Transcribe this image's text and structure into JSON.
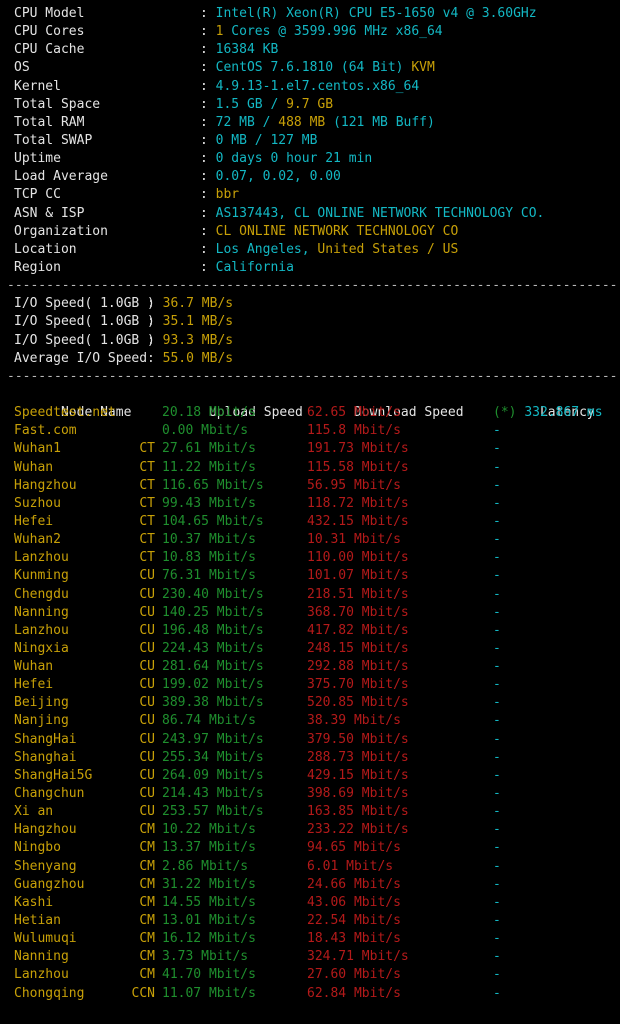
{
  "terminal": {
    "colors": {
      "background": "#000000",
      "label": "#e4e4e4",
      "cyan": "#13b8c4",
      "yellow": "#c7a008",
      "green": "#1f8f2e",
      "red": "#b41a1a",
      "separator": "#b9b9b9"
    },
    "separator_char": "-"
  },
  "system_info": {
    "rows": [
      {
        "label": "CPU Model",
        "colon": ":",
        "parts": [
          {
            "text": "Intel(R) Xeon(R) CPU E5-1650 v4 @ 3.60GHz",
            "color": "cyan"
          }
        ]
      },
      {
        "label": "CPU Cores",
        "colon": ":",
        "parts": [
          {
            "text": "1",
            "color": "yellow"
          },
          {
            "text": " Cores @ 3599.996 MHz x86_64",
            "color": "cyan"
          }
        ]
      },
      {
        "label": "CPU Cache",
        "colon": ":",
        "parts": [
          {
            "text": "16384 KB",
            "color": "cyan"
          }
        ]
      },
      {
        "label": "OS",
        "colon": ":",
        "parts": [
          {
            "text": "CentOS 7.6.1810 (64 Bit) ",
            "color": "cyan"
          },
          {
            "text": "KVM",
            "color": "yellow"
          }
        ]
      },
      {
        "label": "Kernel",
        "colon": ":",
        "parts": [
          {
            "text": "4.9.13-1.el7.centos.x86_64",
            "color": "cyan"
          }
        ]
      },
      {
        "label": "Total Space",
        "colon": ":",
        "parts": [
          {
            "text": "1.5 GB",
            "color": "cyan"
          },
          {
            "text": " / ",
            "color": "cyan"
          },
          {
            "text": "9.7 GB",
            "color": "yellow"
          }
        ]
      },
      {
        "label": "Total RAM",
        "colon": ":",
        "parts": [
          {
            "text": "72 MB",
            "color": "cyan"
          },
          {
            "text": " / ",
            "color": "cyan"
          },
          {
            "text": "488 MB",
            "color": "yellow"
          },
          {
            "text": " (121 MB Buff)",
            "color": "cyan"
          }
        ]
      },
      {
        "label": "Total SWAP",
        "colon": ":",
        "parts": [
          {
            "text": "0 MB / 127 MB",
            "color": "cyan"
          }
        ]
      },
      {
        "label": "Uptime",
        "colon": ":",
        "parts": [
          {
            "text": "0 days 0 hour 21 min",
            "color": "cyan"
          }
        ]
      },
      {
        "label": "Load Average",
        "colon": ":",
        "parts": [
          {
            "text": "0.07, 0.02, 0.00",
            "color": "cyan"
          }
        ]
      },
      {
        "label": "TCP CC",
        "colon": ":",
        "parts": [
          {
            "text": "bbr",
            "color": "yellow"
          }
        ]
      },
      {
        "label": "ASN & ISP",
        "colon": ":",
        "parts": [
          {
            "text": "AS137443, CL ONLINE NETWORK TECHNOLOGY CO.",
            "color": "cyan"
          }
        ]
      },
      {
        "label": "Organization",
        "colon": ":",
        "parts": [
          {
            "text": "CL ONLINE NETWORK TECHNOLOGY CO",
            "color": "yellow"
          }
        ]
      },
      {
        "label": "Location",
        "colon": ":",
        "parts": [
          {
            "text": "Los Angeles, ",
            "color": "cyan"
          },
          {
            "text": "United States / US",
            "color": "yellow"
          }
        ]
      },
      {
        "label": "Region",
        "colon": ":",
        "parts": [
          {
            "text": "California",
            "color": "cyan"
          }
        ]
      }
    ]
  },
  "io_speed": {
    "rows": [
      {
        "label": "I/O Speed( 1.0GB )",
        "colon": ":",
        "value": "36.7 MB/s"
      },
      {
        "label": "I/O Speed( 1.0GB )",
        "colon": ":",
        "value": "35.1 MB/s"
      },
      {
        "label": "I/O Speed( 1.0GB )",
        "colon": ":",
        "value": "93.3 MB/s"
      },
      {
        "label": "Average I/O Speed",
        "colon": ":",
        "value": "55.0 MB/s"
      }
    ]
  },
  "speedtest": {
    "headers": {
      "node": "Node Name",
      "carrier": "",
      "upload": "Upload Speed",
      "download": "Download Speed",
      "latency": "Latency"
    },
    "rows": [
      {
        "node": "Speedtest.net",
        "carrier": "",
        "upload": "20.18 Mbit/s",
        "download": "62.65 Mbit/s",
        "latency_mark": "(*)",
        "latency": "332.867 ms"
      },
      {
        "node": "Fast.com",
        "carrier": "",
        "upload": "0.00 Mbit/s",
        "download": "115.8 Mbit/s",
        "latency_mark": "",
        "latency": "-"
      },
      {
        "node": "Wuhan1",
        "carrier": "CT",
        "upload": "27.61 Mbit/s",
        "download": "191.73 Mbit/s",
        "latency_mark": "",
        "latency": "-"
      },
      {
        "node": "Wuhan",
        "carrier": "CT",
        "upload": "11.22 Mbit/s",
        "download": "115.58 Mbit/s",
        "latency_mark": "",
        "latency": "-"
      },
      {
        "node": "Hangzhou",
        "carrier": "CT",
        "upload": "116.65 Mbit/s",
        "download": "56.95 Mbit/s",
        "latency_mark": "",
        "latency": "-"
      },
      {
        "node": "Suzhou",
        "carrier": "CT",
        "upload": "99.43 Mbit/s",
        "download": "118.72 Mbit/s",
        "latency_mark": "",
        "latency": "-"
      },
      {
        "node": "Hefei",
        "carrier": "CT",
        "upload": "104.65 Mbit/s",
        "download": "432.15 Mbit/s",
        "latency_mark": "",
        "latency": "-"
      },
      {
        "node": "Wuhan2",
        "carrier": "CT",
        "upload": "10.37 Mbit/s",
        "download": "10.31 Mbit/s",
        "latency_mark": "",
        "latency": "-"
      },
      {
        "node": "Lanzhou",
        "carrier": "CT",
        "upload": "10.83 Mbit/s",
        "download": "110.00 Mbit/s",
        "latency_mark": "",
        "latency": "-"
      },
      {
        "node": "Kunming",
        "carrier": "CU",
        "upload": "76.31 Mbit/s",
        "download": "101.07 Mbit/s",
        "latency_mark": "",
        "latency": "-"
      },
      {
        "node": "Chengdu",
        "carrier": "CU",
        "upload": "230.40 Mbit/s",
        "download": "218.51 Mbit/s",
        "latency_mark": "",
        "latency": "-"
      },
      {
        "node": "Nanning",
        "carrier": "CU",
        "upload": "140.25 Mbit/s",
        "download": "368.70 Mbit/s",
        "latency_mark": "",
        "latency": "-"
      },
      {
        "node": "Lanzhou",
        "carrier": "CU",
        "upload": "196.48 Mbit/s",
        "download": "417.82 Mbit/s",
        "latency_mark": "",
        "latency": "-"
      },
      {
        "node": "Ningxia",
        "carrier": "CU",
        "upload": "224.43 Mbit/s",
        "download": "248.15 Mbit/s",
        "latency_mark": "",
        "latency": "-"
      },
      {
        "node": "Wuhan",
        "carrier": "CU",
        "upload": "281.64 Mbit/s",
        "download": "292.88 Mbit/s",
        "latency_mark": "",
        "latency": "-"
      },
      {
        "node": "Hefei",
        "carrier": "CU",
        "upload": "199.02 Mbit/s",
        "download": "375.70 Mbit/s",
        "latency_mark": "",
        "latency": "-"
      },
      {
        "node": "Beijing",
        "carrier": "CU",
        "upload": "389.38 Mbit/s",
        "download": "520.85 Mbit/s",
        "latency_mark": "",
        "latency": "-"
      },
      {
        "node": "Nanjing",
        "carrier": "CU",
        "upload": "86.74 Mbit/s",
        "download": "38.39 Mbit/s",
        "latency_mark": "",
        "latency": "-"
      },
      {
        "node": "ShangHai",
        "carrier": "CU",
        "upload": "243.97 Mbit/s",
        "download": "379.50 Mbit/s",
        "latency_mark": "",
        "latency": "-"
      },
      {
        "node": "Shanghai",
        "carrier": "CU",
        "upload": "255.34 Mbit/s",
        "download": "288.73 Mbit/s",
        "latency_mark": "",
        "latency": "-"
      },
      {
        "node": "ShangHai5G",
        "carrier": "CU",
        "upload": "264.09 Mbit/s",
        "download": "429.15 Mbit/s",
        "latency_mark": "",
        "latency": "-"
      },
      {
        "node": "Changchun",
        "carrier": "CU",
        "upload": "214.43 Mbit/s",
        "download": "398.69 Mbit/s",
        "latency_mark": "",
        "latency": "-"
      },
      {
        "node": "Xi an",
        "carrier": "CU",
        "upload": "253.57 Mbit/s",
        "download": "163.85 Mbit/s",
        "latency_mark": "",
        "latency": "-"
      },
      {
        "node": "Hangzhou",
        "carrier": "CM",
        "upload": "10.22 Mbit/s",
        "download": "233.22 Mbit/s",
        "latency_mark": "",
        "latency": "-"
      },
      {
        "node": "Ningbo",
        "carrier": "CM",
        "upload": "13.37 Mbit/s",
        "download": "94.65 Mbit/s",
        "latency_mark": "",
        "latency": "-"
      },
      {
        "node": "Shenyang",
        "carrier": "CM",
        "upload": "2.86 Mbit/s",
        "download": "6.01 Mbit/s",
        "latency_mark": "",
        "latency": "-"
      },
      {
        "node": "Guangzhou",
        "carrier": "CM",
        "upload": "31.22 Mbit/s",
        "download": "24.66 Mbit/s",
        "latency_mark": "",
        "latency": "-"
      },
      {
        "node": "Kashi",
        "carrier": "CM",
        "upload": "14.55 Mbit/s",
        "download": "43.06 Mbit/s",
        "latency_mark": "",
        "latency": "-"
      },
      {
        "node": "Hetian",
        "carrier": "CM",
        "upload": "13.01 Mbit/s",
        "download": "22.54 Mbit/s",
        "latency_mark": "",
        "latency": "-"
      },
      {
        "node": "Wulumuqi",
        "carrier": "CM",
        "upload": "16.12 Mbit/s",
        "download": "18.43 Mbit/s",
        "latency_mark": "",
        "latency": "-"
      },
      {
        "node": "Nanning",
        "carrier": "CM",
        "upload": "3.73 Mbit/s",
        "download": "324.71 Mbit/s",
        "latency_mark": "",
        "latency": "-"
      },
      {
        "node": "Lanzhou",
        "carrier": "CM",
        "upload": "41.70 Mbit/s",
        "download": "27.60 Mbit/s",
        "latency_mark": "",
        "latency": "-"
      },
      {
        "node": "Chongqing",
        "carrier": "CCN",
        "upload": "11.07 Mbit/s",
        "download": "62.84 Mbit/s",
        "latency_mark": "",
        "latency": "-"
      }
    ]
  }
}
